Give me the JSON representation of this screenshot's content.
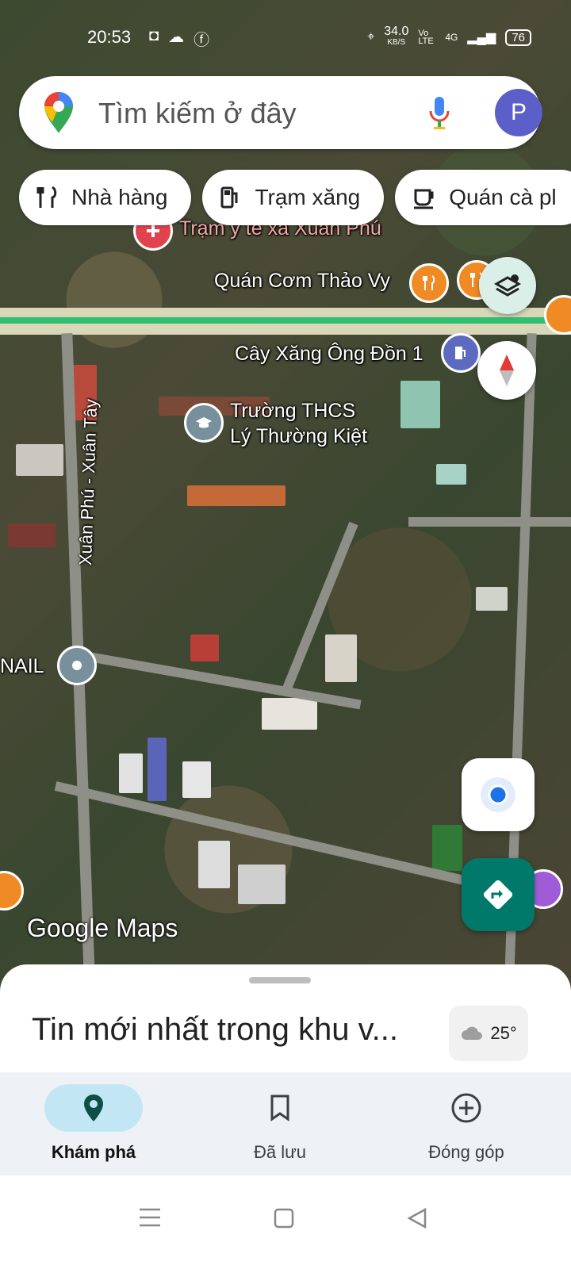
{
  "status_bar": {
    "time": "20:53",
    "network_speed_value": "34.0",
    "network_speed_unit": "KB/S",
    "volte": "Vo LTE",
    "network_type": "4G",
    "battery": "76"
  },
  "search": {
    "placeholder": "Tìm kiếm ở đây",
    "avatar_initial": "P"
  },
  "chips": [
    {
      "label": "Nhà hàng",
      "icon": "restaurant-icon"
    },
    {
      "label": "Trạm xăng",
      "icon": "gas-station-icon"
    },
    {
      "label": "Quán cà pl",
      "icon": "coffee-icon"
    }
  ],
  "map_labels": {
    "health_station": "Trạm y tế xã Xuân Phú",
    "restaurant": "Quán Cơm Thảo Vy",
    "gas_station": "Cây Xăng Ông Đồn 1",
    "school_line1": "Trường THCS",
    "school_line2": "Lý Thường Kiệt",
    "road": "Xuân Phú - Xuân Tây",
    "nail": "NAIL"
  },
  "map_branding": "Google Maps",
  "sheet": {
    "title": "Tin mới nhất trong khu v...",
    "temperature": "25°"
  },
  "bottom_nav": [
    {
      "label": "Khám phá",
      "icon": "explore-pin-icon",
      "active": true
    },
    {
      "label": "Đã lưu",
      "icon": "bookmark-icon",
      "active": false
    },
    {
      "label": "Đóng góp",
      "icon": "add-circle-icon",
      "active": false
    }
  ],
  "colors": {
    "accent_teal": "#00796b",
    "route_green": "#2fbf71",
    "location_blue": "#1a73e8",
    "poi_orange": "#f08a24"
  }
}
